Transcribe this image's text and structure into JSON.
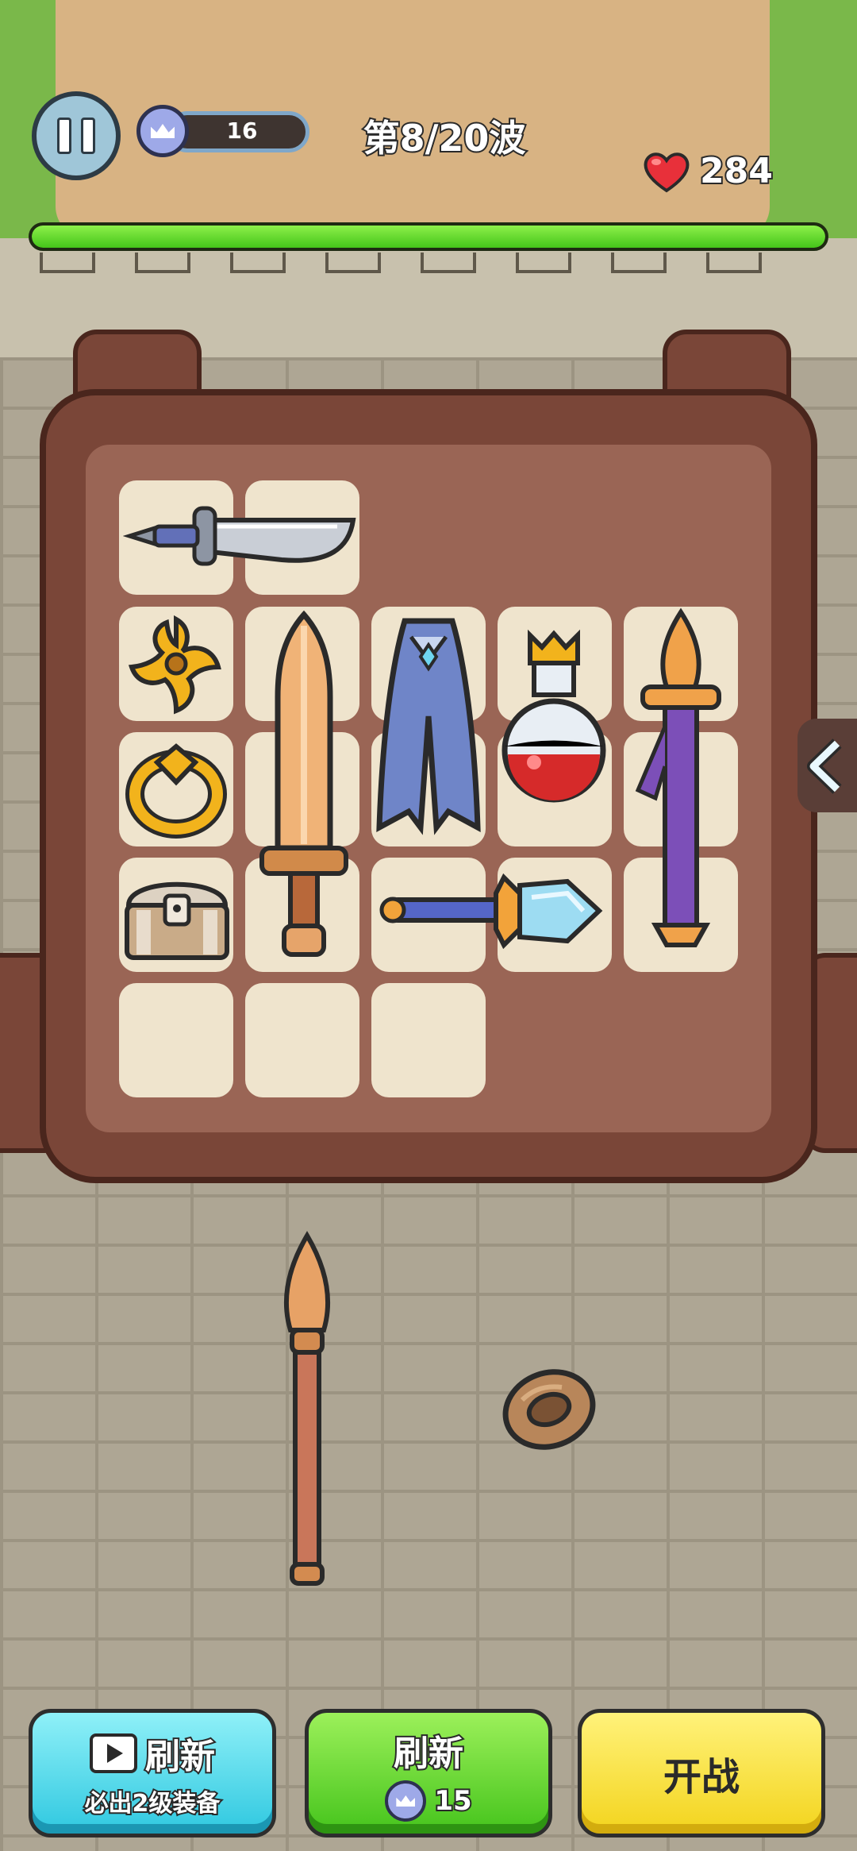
{
  "hud": {
    "gems": "16",
    "wave": "第8/20波",
    "hp": "284",
    "hp_fraction": 1.0
  },
  "bag": {
    "slots_visible": 18
  },
  "buttons": {
    "ad_refresh_title": "刷新",
    "ad_refresh_sub": "必出2级装备",
    "refresh_title": "刷新",
    "refresh_cost": "15",
    "start": "开战"
  },
  "icons": {
    "pause": "pause-icon",
    "gem": "crown-gem-icon",
    "heart": "heart-icon",
    "play": "video-play-icon",
    "side_toggle": "chevron-left-icon"
  },
  "colors": {
    "hp_bar": "#44c51a",
    "ad_button": "#2fc8e0",
    "refresh_button": "#45c41c",
    "start_button": "#f3d41d"
  }
}
